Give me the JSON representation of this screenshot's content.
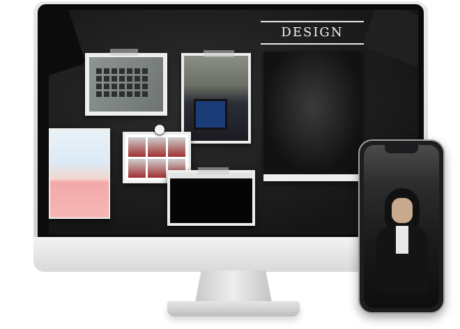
{
  "screen": {
    "heading": "DESIGN"
  },
  "icons": {
    "computer": "imac-icon",
    "phone": "smartphone-icon"
  }
}
